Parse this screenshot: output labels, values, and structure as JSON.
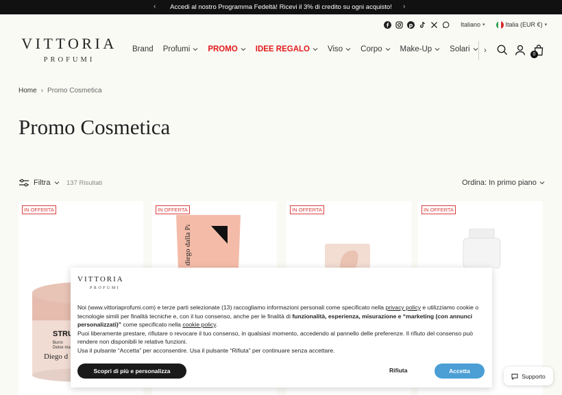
{
  "announcement": {
    "text": "Accedi al nostro Programma Fedeltà! Ricevi il 3% di credito su ogni acquisto!"
  },
  "utility": {
    "socials": [
      "facebook-icon",
      "instagram-icon",
      "pinterest-icon",
      "tiktok-icon",
      "x-icon",
      "whatsapp-icon"
    ],
    "language": "Italiano",
    "country": "Italia (EUR €)"
  },
  "logo": {
    "main": "VITTORIA",
    "sub": "PROFUMI"
  },
  "nav": {
    "brand": "Brand",
    "profumi": "Profumi",
    "promo": "PROMO",
    "idee_regalo": "IDEE REGALO",
    "viso": "Viso",
    "corpo": "Corpo",
    "makeup": "Make-Up",
    "solari": "Solari"
  },
  "cart": {
    "count": "0"
  },
  "breadcrumb": {
    "home": "Home",
    "current": "Promo Cosmetica"
  },
  "page": {
    "title": "Promo Cosmetica"
  },
  "toolbar": {
    "filter": "Filtra",
    "results": "137 Risultati",
    "sort": "Ordina: In primo piano"
  },
  "products": [
    {
      "badge": "IN OFFERTA",
      "label_a": "STRU",
      "label_b": "Burro",
      "label_c": "Detox mas",
      "brand": "Diego d"
    },
    {
      "badge": "IN OFFERTA",
      "brand": "diego dalla Palma"
    },
    {
      "badge": "IN OFFERTA"
    },
    {
      "badge": "IN OFFERTA"
    }
  ],
  "cookie": {
    "logo_main": "VITTORIA",
    "logo_sub": "PROFUMI",
    "p1": "Noi (www.vittoriaprofumi.com) e terze parti selezionate (13) raccogliamo informazioni personali come specificato nella ",
    "privacy_link": "privacy policy",
    "p2": " e utilizziamo cookie o tecnologie simili per finalità tecniche e, con il tuo consenso, anche per le finalità di ",
    "bold": "funzionalità, esperienza, misurazione e “marketing (con annunci personalizzati)”",
    "p3": " come specificato nella ",
    "cookie_link": "cookie policy",
    "p4": ".",
    "p5": "Puoi liberamente prestare, rifiutare o revocare il tuo consenso, in qualsiasi momento, accedendo al pannello delle preferenze. Il rifiuto del consenso può rendere non disponibili le relative funzioni.",
    "p6": "Usa il pulsante “Accetta” per acconsentire. Usa il pulsante “Rifiuta” per continuare senza accettare.",
    "more_btn": "Scopri di più e personalizza",
    "reject_btn": "Rifiuta",
    "accept_btn": "Accetta"
  },
  "support": {
    "label": "Supporto"
  },
  "colors": {
    "accent_red": "#e01b1b",
    "accept_blue": "#4b9fd5",
    "background": "#fafaf5"
  }
}
